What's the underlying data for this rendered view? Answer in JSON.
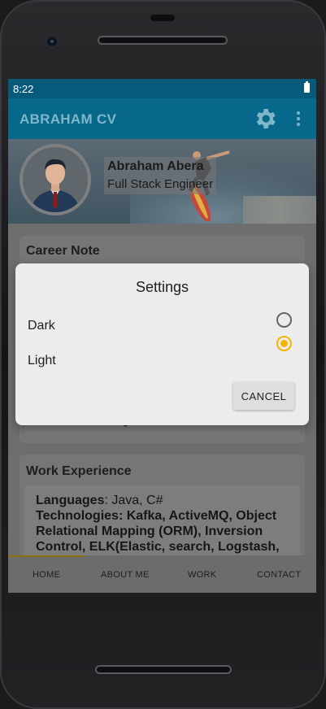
{
  "status_bar": {
    "time": "8:22"
  },
  "app_bar": {
    "title": "ABRAHAM CV"
  },
  "profile": {
    "name": "Abraham Abera",
    "role": "Full Stack Engineer"
  },
  "career_note": {
    "title": "Career Note",
    "partial_text": "on-time delivery."
  },
  "work_experience": {
    "title": "Work Experience",
    "languages_label": "Languages",
    "languages_value": ": Java, C#",
    "technologies": "Technologies: Kafka, ActiveMQ, Object Relational Mapping (ORM), Inversion Control, ELK(Elastic, search, Logstash,"
  },
  "bottom_nav": {
    "items": [
      "HOME",
      "ABOUT ME",
      "WORK",
      "CONTACT"
    ],
    "active_index": 0
  },
  "dialog": {
    "title": "Settings",
    "options": [
      {
        "label": "Dark",
        "selected": false
      },
      {
        "label": "Light",
        "selected": true
      }
    ],
    "cancel_label": "CANCEL"
  },
  "colors": {
    "accent": "#f4b400",
    "app_bar": "#07688b",
    "status_bar": "#075a7a"
  }
}
